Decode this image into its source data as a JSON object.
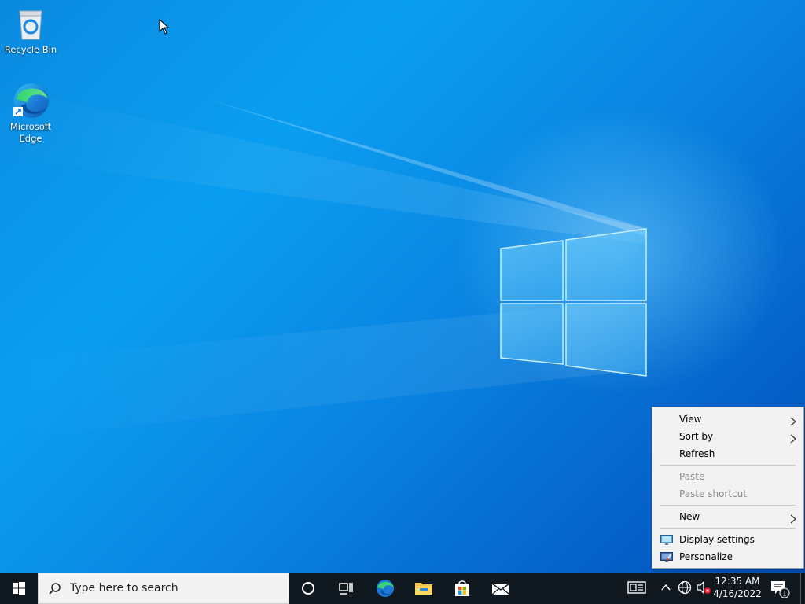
{
  "desktop": {
    "icons": [
      {
        "label": "Recycle Bin",
        "icon": "recycle-bin-icon"
      },
      {
        "label": "Microsoft Edge",
        "icon": "edge-icon"
      }
    ]
  },
  "context_menu": {
    "items": [
      {
        "label": "View",
        "submenu": true,
        "enabled": true
      },
      {
        "label": "Sort by",
        "submenu": true,
        "enabled": true
      },
      {
        "label": "Refresh",
        "submenu": false,
        "enabled": true
      },
      {
        "label": "Paste",
        "submenu": false,
        "enabled": false
      },
      {
        "label": "Paste shortcut",
        "submenu": false,
        "enabled": false
      },
      {
        "label": "New",
        "submenu": true,
        "enabled": true
      },
      {
        "label": "Display settings",
        "submenu": false,
        "enabled": true,
        "icon": "display-icon"
      },
      {
        "label": "Personalize",
        "submenu": false,
        "enabled": true,
        "icon": "personalize-icon"
      }
    ]
  },
  "taskbar": {
    "search_placeholder": "Type here to search",
    "pinned": [
      "cortana-icon",
      "task-view-icon",
      "edge-icon",
      "file-explorer-icon",
      "store-icon",
      "mail-icon"
    ],
    "tray": {
      "icons": [
        "news-icon",
        "chevron-up-icon",
        "network-icon",
        "volume-muted-icon"
      ],
      "time": "12:35 AM",
      "date": "4/16/2022",
      "notification_count": "1"
    }
  },
  "colors": {
    "accent": "#0078d7",
    "taskbar": "#101820",
    "menu_bg": "#f2f2f2"
  }
}
